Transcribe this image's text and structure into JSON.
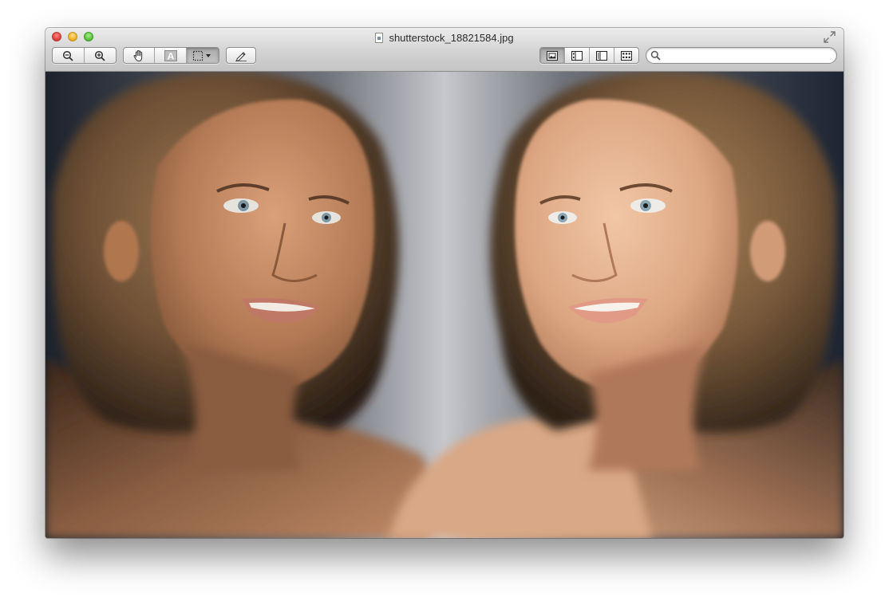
{
  "window": {
    "title": "shutterstock_18821584.jpg",
    "traffic_lights": [
      "close",
      "minimize",
      "zoom"
    ]
  },
  "toolbar": {
    "zoom_group": [
      {
        "name": "zoom-out-icon",
        "tooltip": ""
      },
      {
        "name": "zoom-in-icon",
        "tooltip": ""
      }
    ],
    "tools_group": [
      {
        "name": "hand-tool-icon"
      },
      {
        "name": "text-select-icon"
      },
      {
        "name": "rect-select-icon"
      }
    ],
    "annotate_icon": "pencil-icon",
    "view_group": [
      {
        "name": "content-only-view-icon",
        "active": true
      },
      {
        "name": "thumbnails-view-icon",
        "active": false
      },
      {
        "name": "table-of-contents-view-icon",
        "active": false
      },
      {
        "name": "contact-sheet-view-icon",
        "active": false
      }
    ],
    "search": {
      "value": "",
      "placeholder": ""
    }
  },
  "colors": {
    "titlebar_top": "#ececec",
    "titlebar_bottom": "#c4c4c4",
    "close": "#e0443e",
    "minimize": "#f2b32c",
    "zoom": "#5ec53f"
  }
}
